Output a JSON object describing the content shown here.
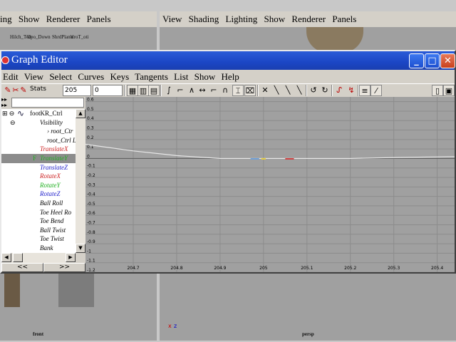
{
  "left_viewport": {
    "menu": [
      "ing",
      "Show",
      "Renderer",
      "Panels"
    ],
    "node_labels": [
      "Hilch_Tob",
      "Upo_Down",
      "ShrdPlanb",
      "droT_oti"
    ],
    "label": "front"
  },
  "right_viewport": {
    "menu": [
      "View",
      "Shading",
      "Lighting",
      "Show",
      "Renderer",
      "Panels"
    ],
    "label": "persp",
    "axis_x": "x",
    "axis_z": "z"
  },
  "graph_editor": {
    "title": "Graph Editor",
    "window_buttons": {
      "minimize": "_",
      "maximize": "□",
      "close": "✕"
    },
    "menu": [
      "Edit",
      "View",
      "Select",
      "Curves",
      "Keys",
      "Tangents",
      "List",
      "Show",
      "Help"
    ],
    "stats_label": "Stats",
    "stats_frame": "205",
    "stats_value": "0",
    "outliner": {
      "rows": [
        {
          "text": "footKR_Ctrl",
          "color": "#000000",
          "indent": 14,
          "italic": false,
          "prefix": "⊞ ⊖",
          "selected": false
        },
        {
          "text": "Visibility",
          "color": "#000000",
          "indent": 54,
          "italic": true,
          "prefix": "⊖",
          "selected": false
        },
        {
          "text": "› root_Ctr",
          "color": "#000000",
          "indent": 64,
          "italic": true,
          "prefix": "",
          "selected": false
        },
        {
          "text": "root_Ctrl L",
          "color": "#000000",
          "indent": 64,
          "italic": true,
          "prefix": "",
          "selected": false
        },
        {
          "text": "TranslateX",
          "color": "#cc2020",
          "indent": 54,
          "italic": true,
          "prefix": "",
          "selected": false
        },
        {
          "text": "TranslateY",
          "color": "#20b020",
          "indent": 54,
          "italic": true,
          "prefix": "F",
          "selected": true
        },
        {
          "text": "TranslateZ",
          "color": "#2020cc",
          "indent": 54,
          "italic": true,
          "prefix": "",
          "selected": false
        },
        {
          "text": "RotateX",
          "color": "#cc2020",
          "indent": 54,
          "italic": true,
          "prefix": "",
          "selected": false
        },
        {
          "text": "RotateY",
          "color": "#20b020",
          "indent": 54,
          "italic": true,
          "prefix": "",
          "selected": false
        },
        {
          "text": "RotateZ",
          "color": "#2020cc",
          "indent": 54,
          "italic": true,
          "prefix": "",
          "selected": false
        },
        {
          "text": "Ball Roll",
          "color": "#000000",
          "indent": 54,
          "italic": true,
          "prefix": "",
          "selected": false
        },
        {
          "text": "Toe Heel Ro",
          "color": "#000000",
          "indent": 54,
          "italic": true,
          "prefix": "",
          "selected": false
        },
        {
          "text": "Toe Bend",
          "color": "#000000",
          "indent": 54,
          "italic": true,
          "prefix": "",
          "selected": false
        },
        {
          "text": "Ball Twist",
          "color": "#000000",
          "indent": 54,
          "italic": true,
          "prefix": "",
          "selected": false
        },
        {
          "text": "Toe Twist",
          "color": "#000000",
          "indent": 54,
          "italic": true,
          "prefix": "",
          "selected": false
        },
        {
          "text": "Bank",
          "color": "#000000",
          "indent": 54,
          "italic": true,
          "prefix": "",
          "selected": false
        }
      ],
      "bottom_left": "<<",
      "bottom_right": ">>"
    }
  },
  "chart_data": {
    "type": "line",
    "xlim": [
      204.59,
      205.44
    ],
    "ylim": [
      -1.2,
      0.65
    ],
    "x_ticks": [
      204.7,
      204.8,
      204.9,
      205,
      205.1,
      205.2,
      205.3,
      205.4
    ],
    "x_tick_labels": [
      "204.7",
      "204.8",
      "204.9",
      "205",
      "205.1",
      "205.2",
      "205.3",
      "205.4"
    ],
    "y_ticks": [
      0.6,
      0.5,
      0.4,
      0.3,
      0.2,
      0.1,
      0,
      -0.1,
      -0.2,
      -0.3,
      -0.4,
      -0.5,
      -0.6,
      -0.7,
      -0.8,
      -0.9,
      -1,
      -1.1,
      -1.2
    ],
    "y_tick_labels": [
      "0.6",
      "0.5",
      "0.4",
      "0.3",
      "0.2",
      "0.1",
      "0",
      "-0.1",
      "-0.2",
      "-0.3",
      "-0.4",
      "-0.5",
      "-0.6",
      "-0.7",
      "-0.8",
      "-0.9",
      "-1",
      "-1.1",
      "-1.2"
    ],
    "grid": true,
    "series": [
      {
        "color": "#e8e8e8",
        "x": [
          204.59,
          204.7,
          204.8,
          204.9,
          205.0,
          205.1,
          205.2,
          205.3,
          205.44
        ],
        "y": [
          0.15,
          0.08,
          0.03,
          0.0,
          0.0,
          0.0,
          0.0,
          0.01,
          0.02
        ]
      }
    ],
    "highlight_segments": [
      {
        "color": "#6fa0d8",
        "x": [
          204.97,
          204.99
        ],
        "y": [
          0.0,
          0.0
        ]
      },
      {
        "color": "#e8d040",
        "x": [
          204.995,
          205.005
        ],
        "y": [
          0.0,
          0.0
        ]
      },
      {
        "color": "#d04040",
        "x": [
          205.05,
          205.07
        ],
        "y": [
          0.0,
          0.0
        ]
      }
    ]
  }
}
